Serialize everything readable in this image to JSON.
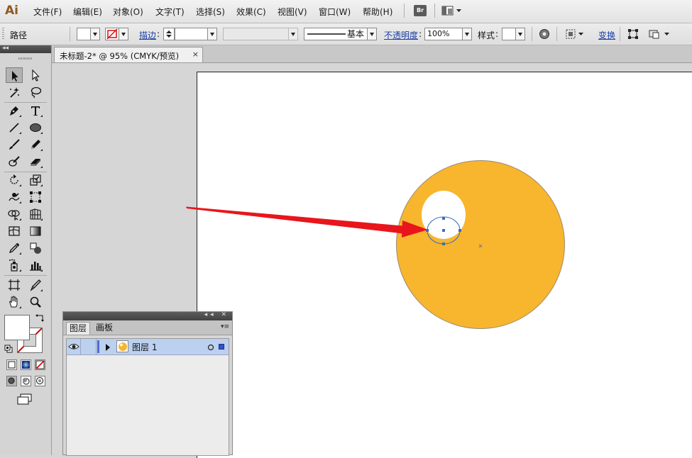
{
  "app": {
    "logo": "Ai",
    "menu": [
      "文件(F)",
      "编辑(E)",
      "对象(O)",
      "文字(T)",
      "选择(S)",
      "效果(C)",
      "视图(V)",
      "窗口(W)",
      "帮助(H)"
    ],
    "bridge_label": "Br",
    "workspace_icon": "workspace-layout-icon"
  },
  "control_bar": {
    "object_type": "路径",
    "stroke_label": "描边",
    "brush_style": "基本",
    "opacity_label": "不透明度",
    "opacity_value": "100%",
    "style_label": "样式",
    "transform_label": "变换"
  },
  "document": {
    "tab_title": "未标题-2* @ 95% (CMYK/预览)",
    "close_glyph": "×"
  },
  "artwork": {
    "big_circle_color": "#f8b52e",
    "hole_color": "#ffffff",
    "arrow_color": "#e8161c",
    "selection_color": "#3f6fb8"
  },
  "tools": {
    "icons": [
      "selection-tool-icon",
      "direct-selection-tool-icon",
      "magic-wand-tool-icon",
      "lasso-tool-icon",
      "pen-tool-icon",
      "type-tool-icon",
      "line-tool-icon",
      "ellipse-tool-icon",
      "paintbrush-tool-icon",
      "pencil-tool-icon",
      "blob-brush-tool-icon",
      "eraser-tool-icon",
      "rotate-tool-icon",
      "scale-tool-icon",
      "warp-tool-icon",
      "free-transform-tool-icon",
      "shape-builder-tool-icon",
      "perspective-grid-tool-icon",
      "mesh-tool-icon",
      "gradient-tool-icon",
      "eyedropper-tool-icon",
      "blend-tool-icon",
      "symbol-sprayer-tool-icon",
      "column-graph-tool-icon",
      "artboard-tool-icon",
      "slice-tool-icon",
      "hand-tool-icon",
      "zoom-tool-icon"
    ]
  },
  "layers_panel": {
    "tabs": [
      "图层",
      "画板"
    ],
    "active_tab": "图层",
    "layer_name": "图层 1"
  }
}
